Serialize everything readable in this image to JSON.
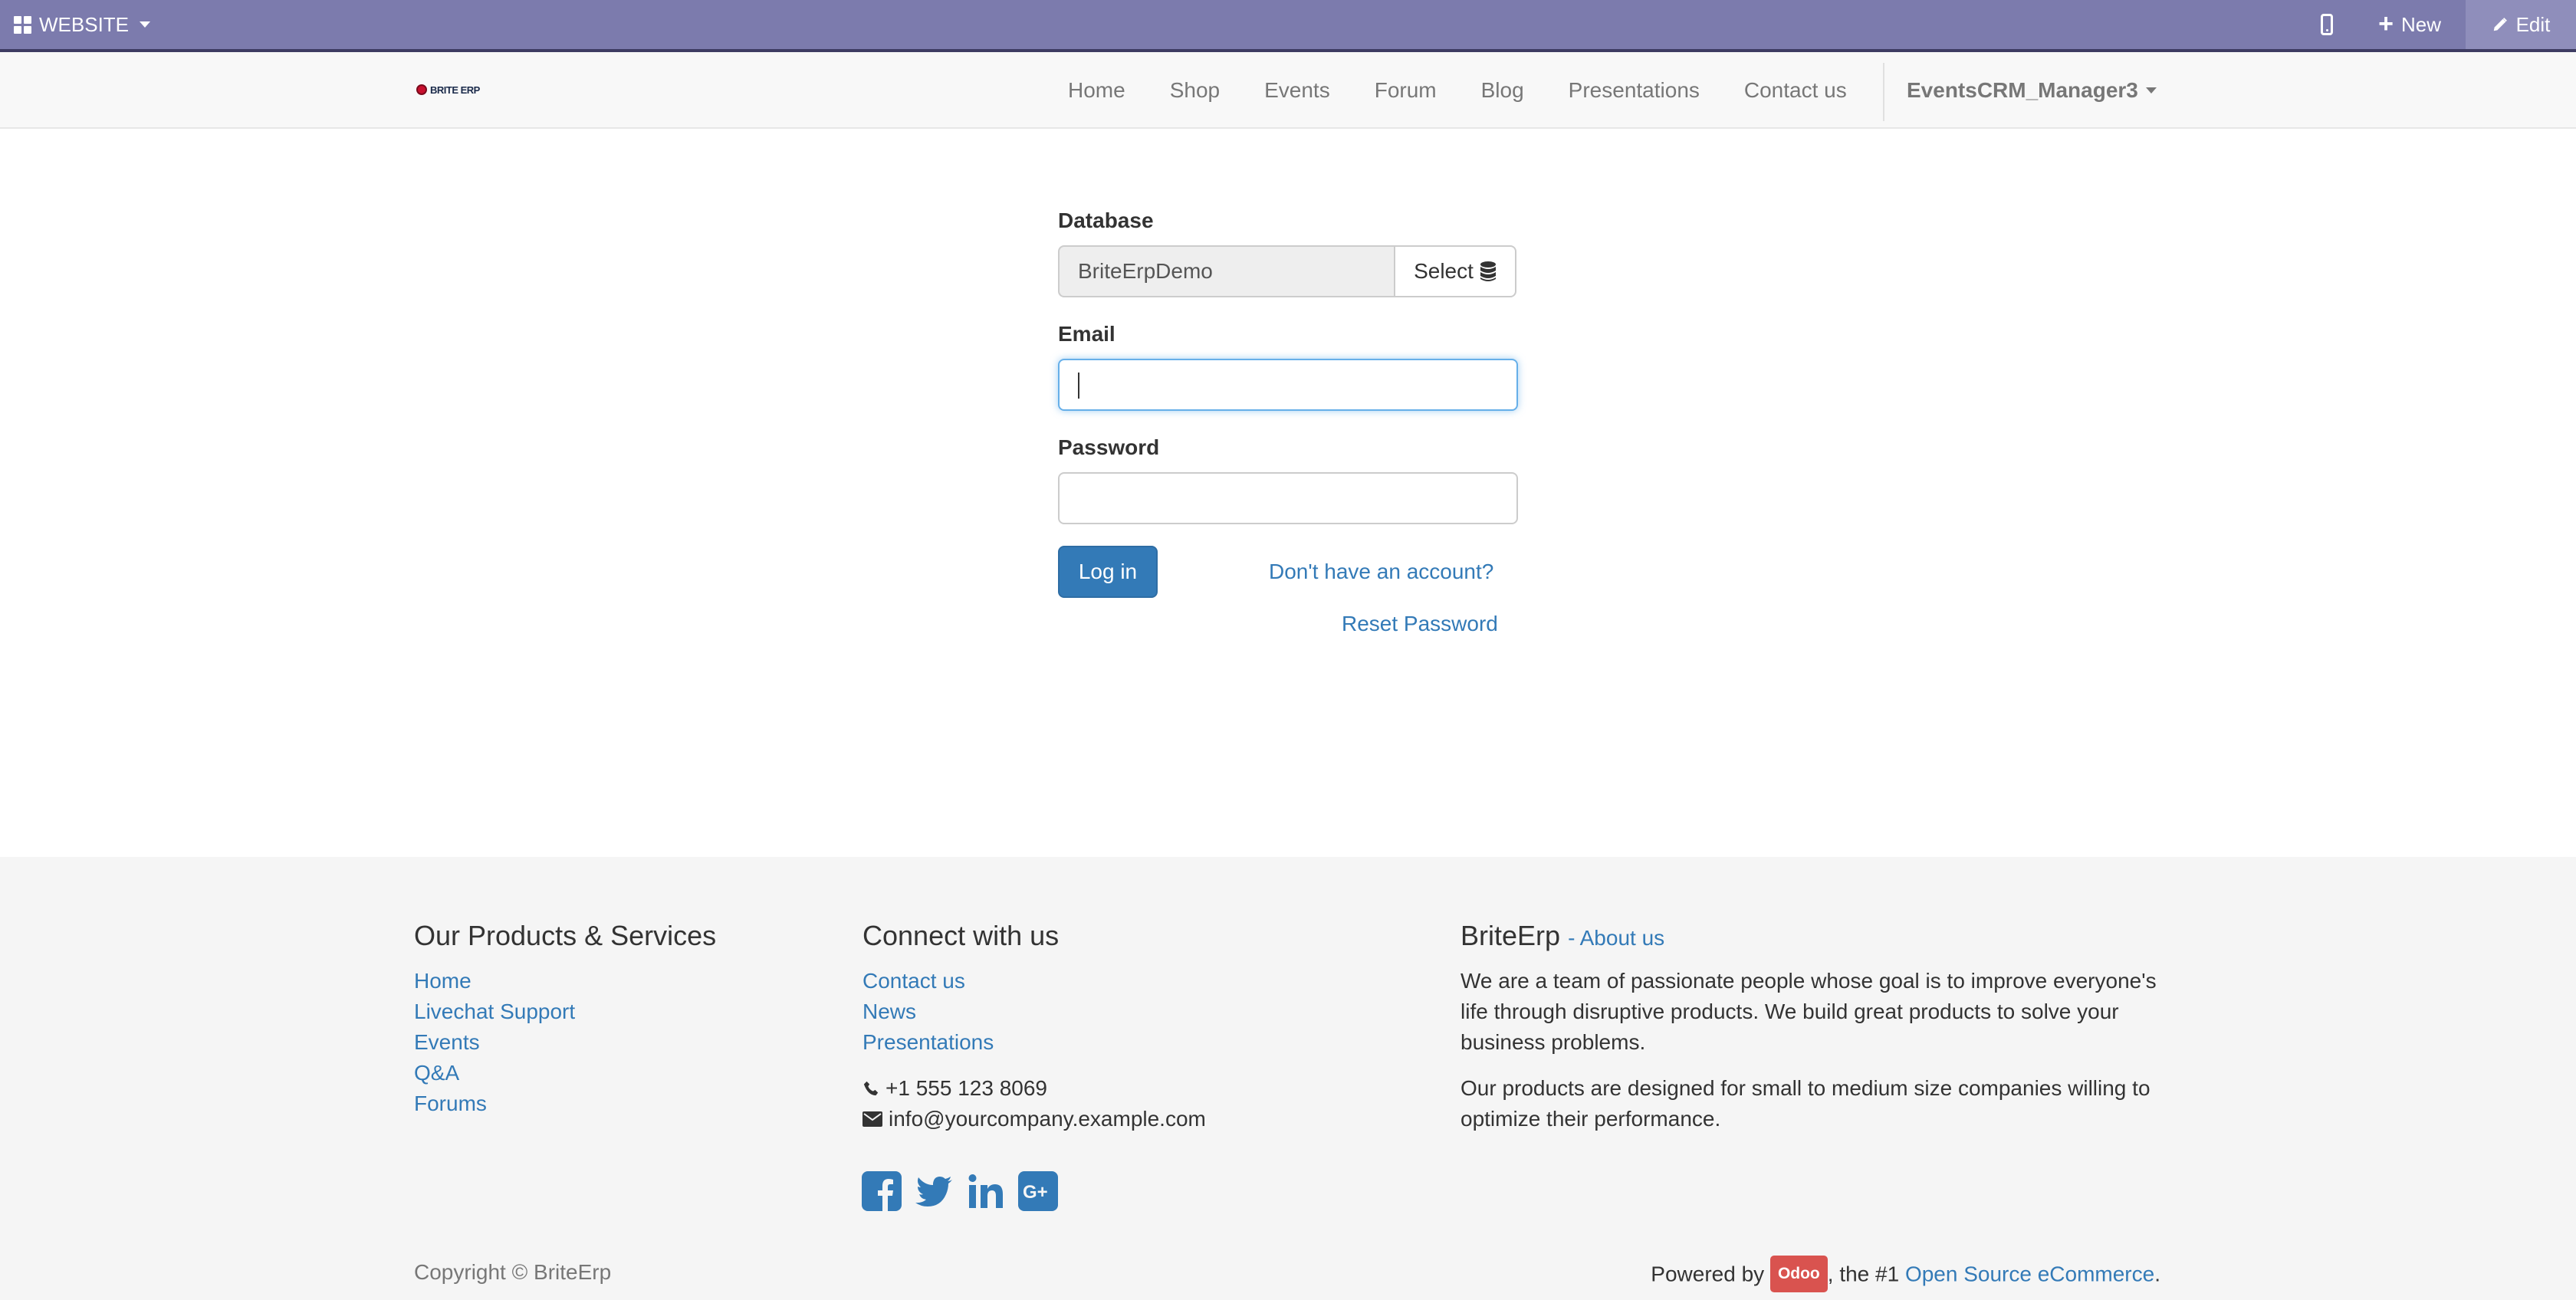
{
  "admin_bar": {
    "website_label": "WEBSITE",
    "new_label": "New",
    "edit_label": "Edit"
  },
  "header": {
    "logo_text": "BRITE ERP",
    "nav": [
      "Home",
      "Shop",
      "Events",
      "Forum",
      "Blog",
      "Presentations",
      "Contact us"
    ],
    "user": "EventsCRM_Manager3"
  },
  "login": {
    "database_label": "Database",
    "database_value": "BriteErpDemo",
    "select_label": "Select",
    "email_label": "Email",
    "email_value": "",
    "password_label": "Password",
    "password_value": "",
    "login_button": "Log in",
    "signup_link": "Don't have an account?",
    "reset_link": "Reset Password"
  },
  "footer": {
    "products_heading": "Our Products & Services",
    "products_links": [
      "Home",
      "Livechat Support",
      "Events",
      "Q&A",
      "Forums"
    ],
    "connect_heading": "Connect with us",
    "connect_links": [
      "Contact us",
      "News",
      "Presentations"
    ],
    "phone": "+1 555 123 8069",
    "email": "info@yourcompany.example.com",
    "social": [
      "facebook-icon",
      "twitter-icon",
      "linkedin-icon",
      "google-plus-icon"
    ],
    "about_title": "BriteErp",
    "about_link": "- About us",
    "about_p1_lines": [
      "We are a team of passionate people whose goal is to improve everyone's",
      "life through disruptive products. We build great products to solve your",
      "business problems."
    ],
    "about_p2_lines": [
      "Our products are designed for small to medium size companies willing to",
      "optimize their performance."
    ],
    "copyright": "Copyright © BriteErp",
    "powered_by": "Powered by",
    "odoo_badge": "Odoo",
    "powered_mid": ", the #1",
    "powered_link": "Open Source eCommerce",
    "powered_end": "."
  },
  "colors": {
    "admin_bar": "#7c7bad",
    "link": "#337ab7",
    "primary_button": "#337ab7",
    "odoo_badge": "#d9534f",
    "footer_bg": "#f5f5f5"
  }
}
